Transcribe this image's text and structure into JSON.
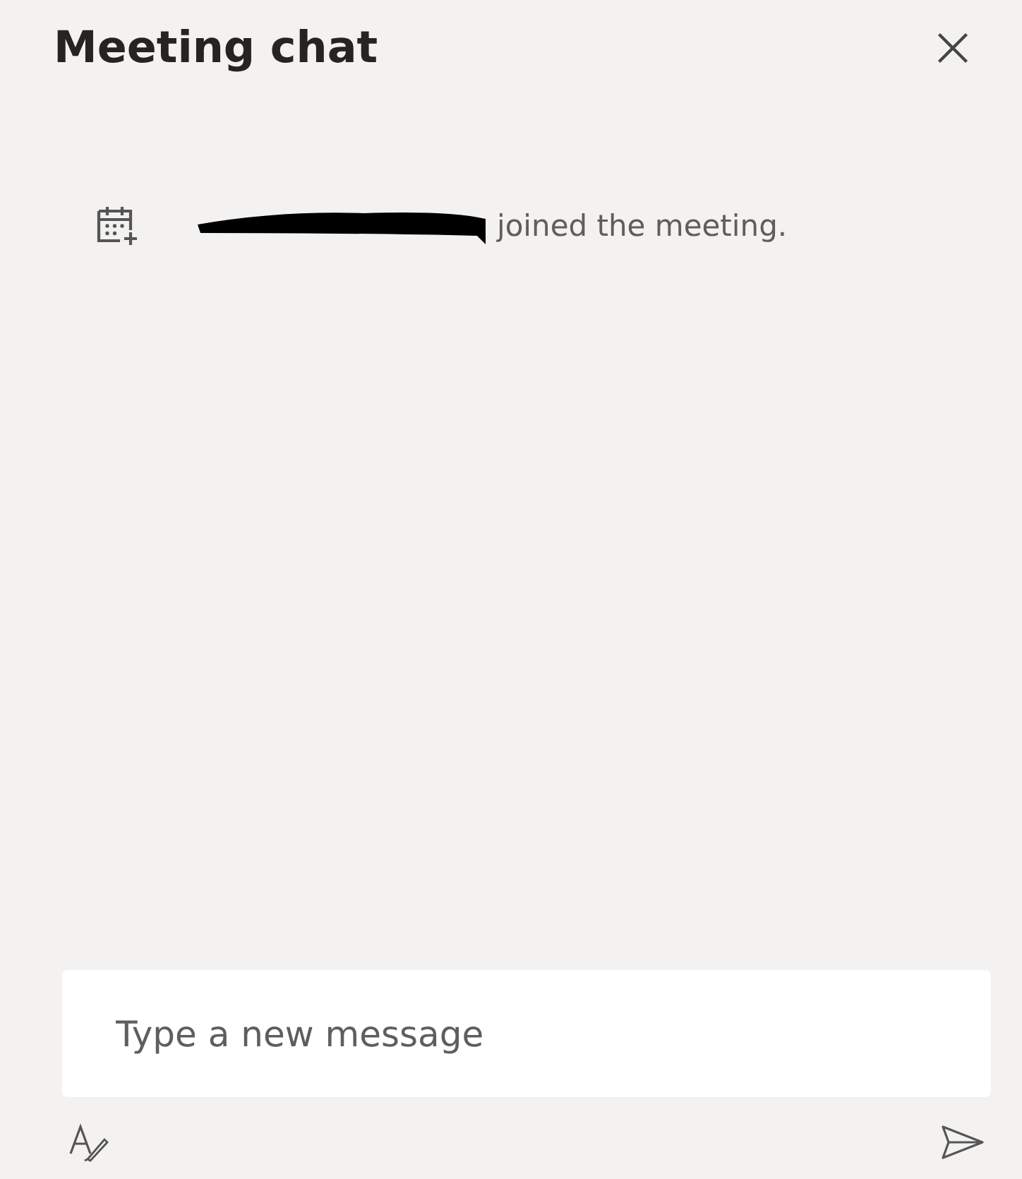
{
  "header": {
    "title": "Meeting chat"
  },
  "events": [
    {
      "kind": "join",
      "redacted": true,
      "text": "joined the meeting."
    }
  ],
  "composer": {
    "placeholder": "Type a new message"
  }
}
